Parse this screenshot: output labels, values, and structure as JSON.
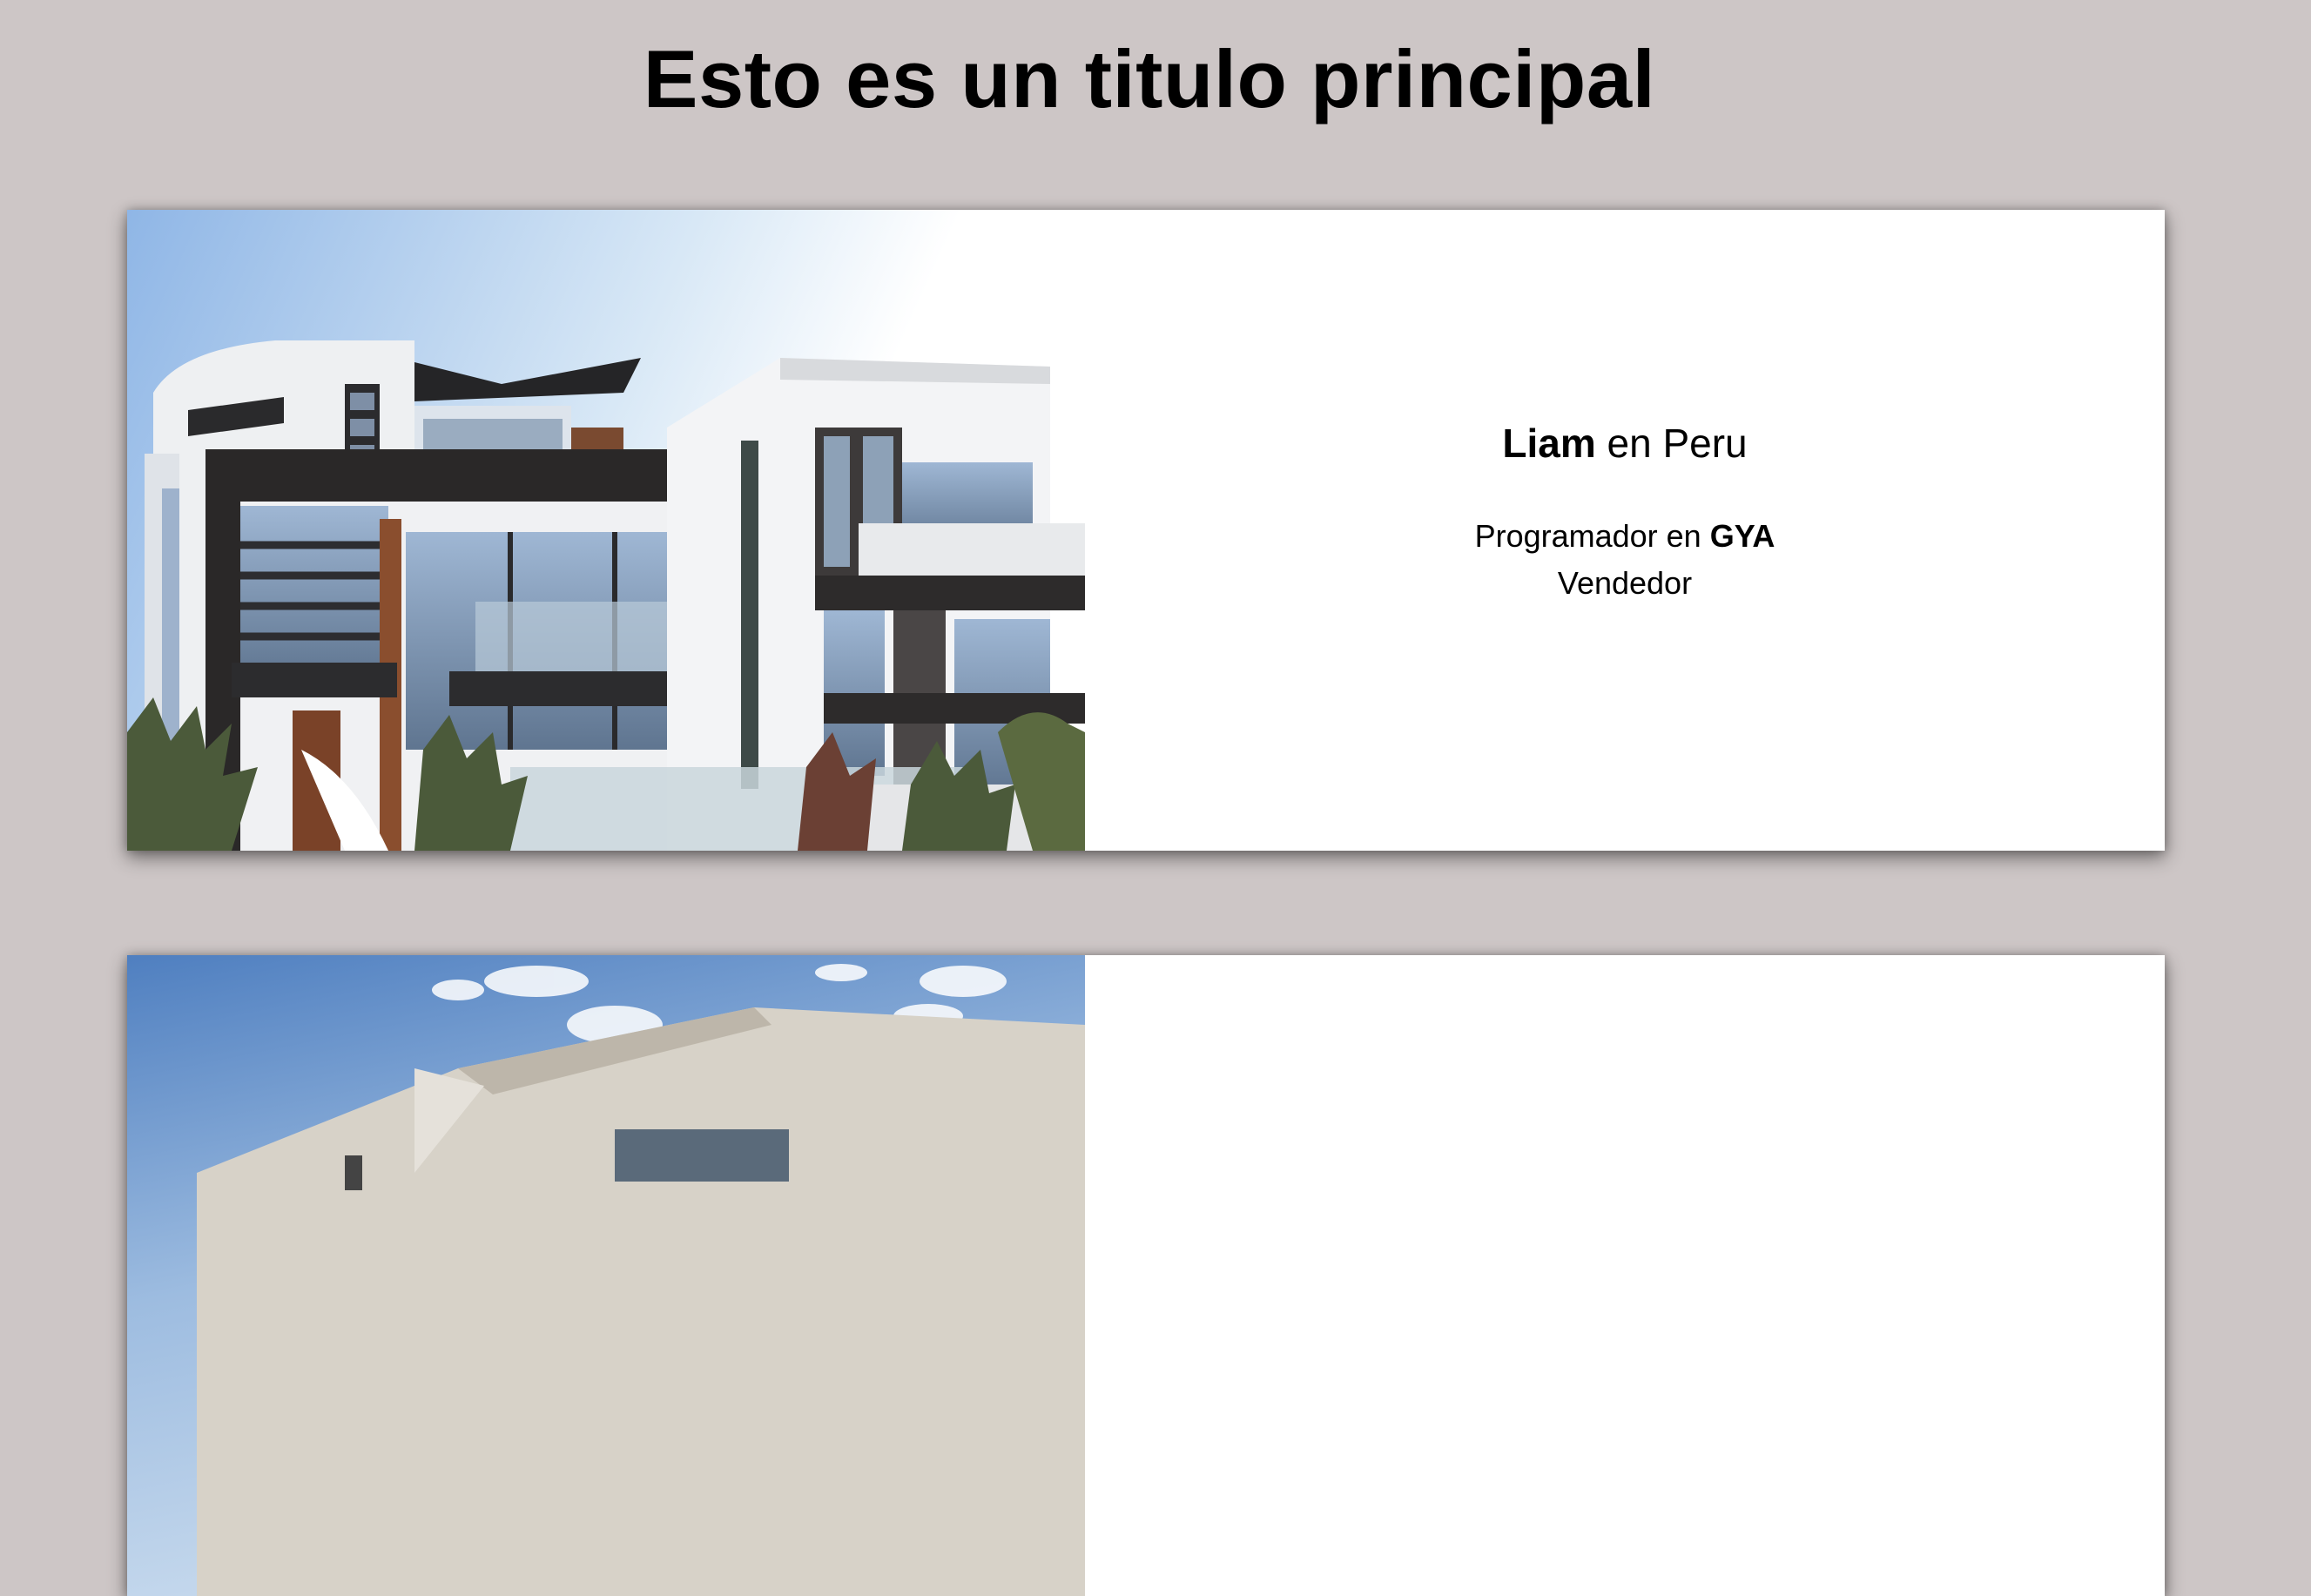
{
  "page": {
    "title": "Esto es un titulo principal"
  },
  "cards": [
    {
      "name": "Liam",
      "location_text": " en Peru",
      "job_prefix": "Programador en ",
      "company": "GYA",
      "role": "Vendedor",
      "image_icon": "modern-house-photo"
    },
    {
      "image_icon": "modern-house-photo"
    }
  ],
  "colors": {
    "background": "#cdc6c6",
    "card": "#ffffff",
    "text": "#000000"
  }
}
